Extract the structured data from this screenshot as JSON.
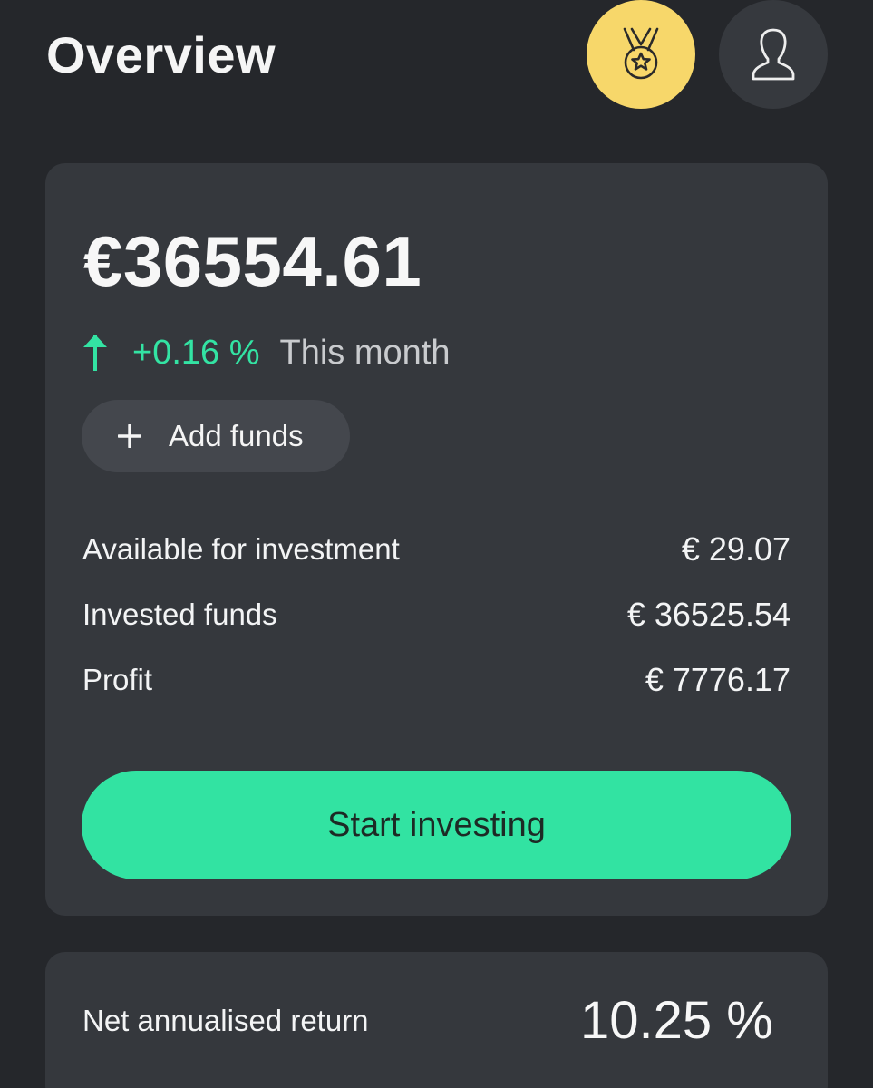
{
  "header": {
    "title": "Overview",
    "medal_icon": "medal-star-icon",
    "profile_icon": "user-profile-icon"
  },
  "balance": {
    "amount": "€36554.61",
    "change_value": "+0.16 %",
    "change_period": "This month",
    "change_icon": "arrow-up-icon",
    "change_color": "#33e3a3"
  },
  "actions": {
    "add_funds_label": "Add funds",
    "add_funds_icon": "plus-icon",
    "start_investing_label": "Start investing"
  },
  "stats": [
    {
      "label": "Available for investment",
      "value": "€ 29.07"
    },
    {
      "label": "Invested funds",
      "value": "€ 36525.54"
    },
    {
      "label": "Profit",
      "value": "€ 7776.17"
    }
  ],
  "return": {
    "label": "Net annualised return",
    "value": "10.25 %"
  },
  "colors": {
    "background": "#25272b",
    "card": "#35383d",
    "accent": "#32e3a2",
    "medal_bg": "#f7d76a"
  }
}
